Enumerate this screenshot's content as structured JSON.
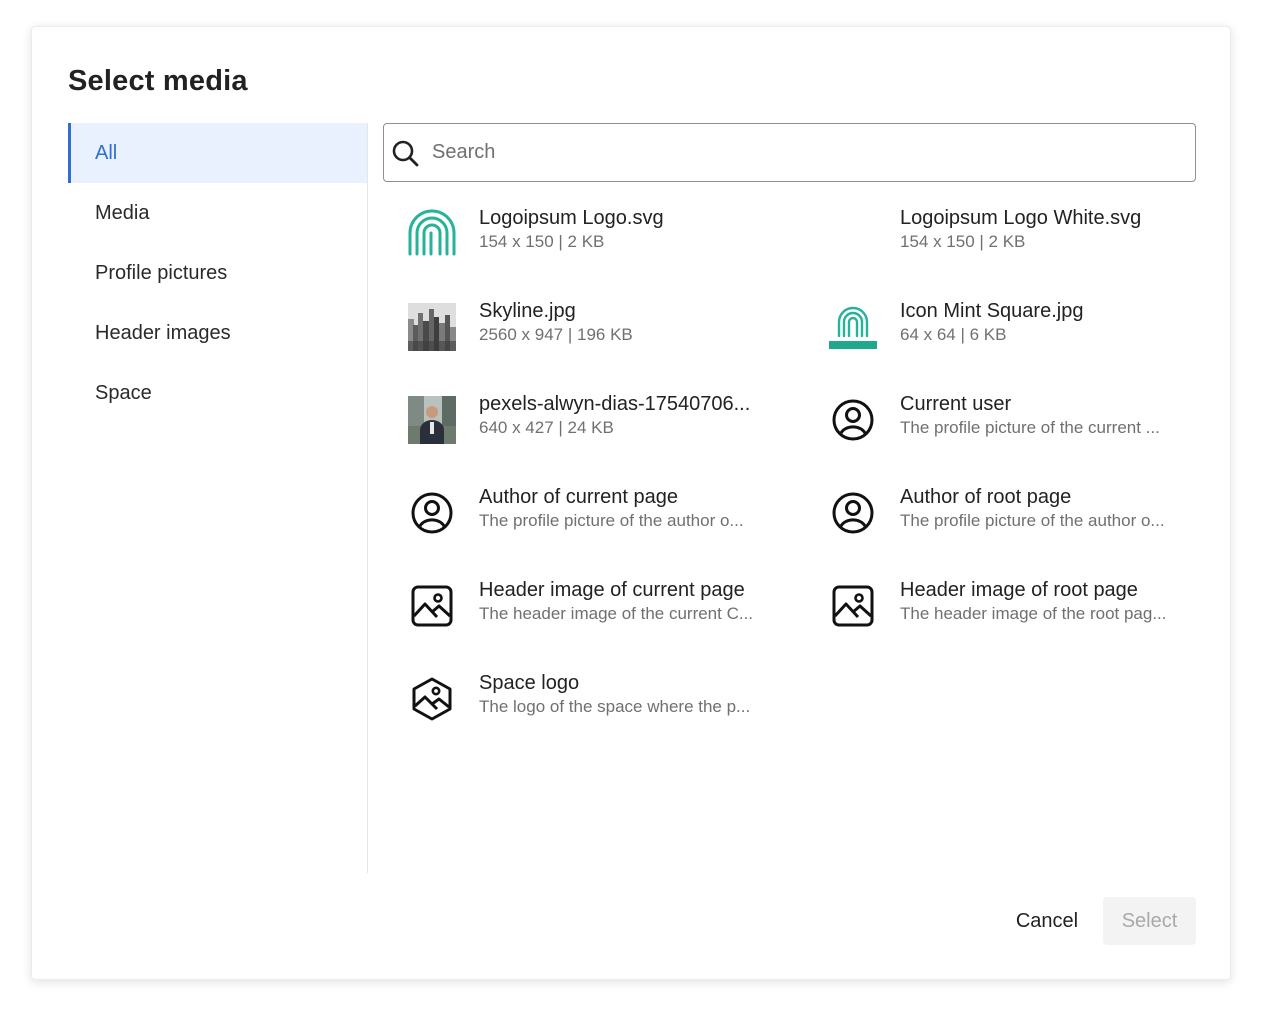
{
  "dialog": {
    "title": "Select media"
  },
  "sidebar": {
    "items": [
      {
        "label": "All",
        "active": true
      },
      {
        "label": "Media",
        "active": false
      },
      {
        "label": "Profile pictures",
        "active": false
      },
      {
        "label": "Header images",
        "active": false
      },
      {
        "label": "Space",
        "active": false
      }
    ]
  },
  "search": {
    "placeholder": "Search",
    "value": ""
  },
  "media": {
    "items": [
      {
        "title": "Logoipsum Logo.svg",
        "subtitle": "154 x 150 | 2 KB",
        "icon": "fingerprint-logo-icon"
      },
      {
        "title": "Logoipsum Logo White.svg",
        "subtitle": "154 x 150 | 2 KB",
        "icon": "blank-thumbnail"
      },
      {
        "title": "Skyline.jpg",
        "subtitle": "2560 x 947 | 196 KB",
        "icon": "skyline-thumbnail"
      },
      {
        "title": "Icon Mint Square.jpg",
        "subtitle": "64 x 64 | 6 KB",
        "icon": "mint-logo-thumbnail"
      },
      {
        "title": "pexels-alwyn-dias-17540706...",
        "subtitle": "640 x 427 | 24 KB",
        "icon": "person-photo-thumbnail"
      },
      {
        "title": "Current user",
        "subtitle": "The profile picture of the current ...",
        "icon": "user-circle-icon"
      },
      {
        "title": "Author of current page",
        "subtitle": "The profile picture of the author o...",
        "icon": "user-circle-icon"
      },
      {
        "title": "Author of root page",
        "subtitle": "The profile picture of the author o...",
        "icon": "user-circle-icon"
      },
      {
        "title": "Header image of current page",
        "subtitle": "The header image of the current C...",
        "icon": "image-icon"
      },
      {
        "title": "Header image of root page",
        "subtitle": "The header image of the root pag...",
        "icon": "image-icon"
      },
      {
        "title": "Space logo",
        "subtitle": "The logo of the space where the p...",
        "icon": "hexagon-image-icon"
      }
    ]
  },
  "footer": {
    "cancel_label": "Cancel",
    "select_label": "Select"
  },
  "colors": {
    "accent": "#2f6fd1",
    "active_bg": "#e8f1fd",
    "mint": "#25b39a",
    "muted_text": "#707070"
  }
}
